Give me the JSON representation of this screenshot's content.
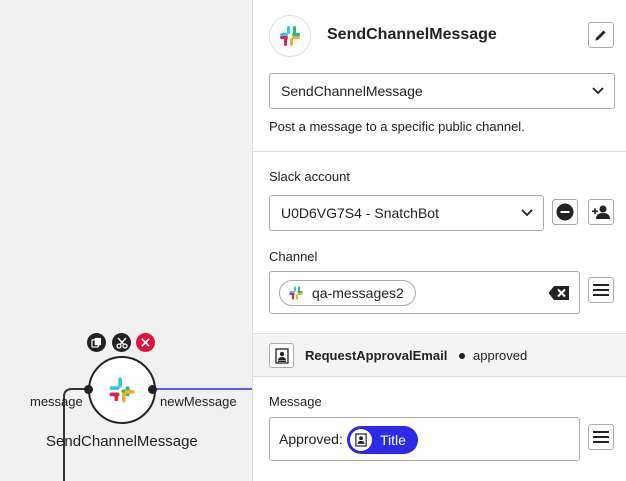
{
  "canvas": {
    "node": {
      "title": "SendChannelMessage",
      "input_label": "message",
      "output_label": "newMessage",
      "icon": "slack-logo-icon",
      "tools": [
        "copy-icon",
        "scissors-icon",
        "close-icon"
      ]
    }
  },
  "panel": {
    "header": {
      "title": "SendChannelMessage",
      "app_icon": "slack-logo-icon",
      "edit_icon": "pencil-icon"
    },
    "method_select": {
      "value": "SendChannelMessage",
      "icon": "chevron-down-icon"
    },
    "description": "Post a message to a specific public channel.",
    "slack_account": {
      "label": "Slack account",
      "value": "U0D6VG7S4 - SnatchBot",
      "remove_icon": "minus-circle-icon",
      "add_icon": "add-user-icon"
    },
    "channel": {
      "label": "Channel",
      "chip_text": "qa-messages2",
      "clear_icon": "backspace-icon",
      "menu_icon": "hamburger-icon"
    },
    "source": {
      "name": "RequestApprovalEmail",
      "field": "approved",
      "icon": "document-user-icon"
    },
    "message": {
      "label": "Message",
      "prefix": "Approved:",
      "variable": "Title",
      "menu_icon": "hamburger-icon"
    }
  },
  "colors": {
    "accent": "#2b2be8",
    "delete": "#e0123c",
    "slack_blue": "#36c5f0",
    "slack_green": "#2eb67d",
    "slack_yellow": "#ecb22e",
    "slack_red": "#e01e5a"
  }
}
